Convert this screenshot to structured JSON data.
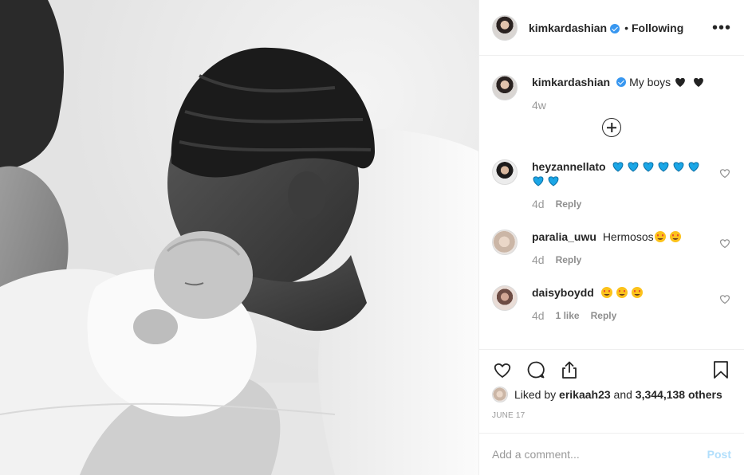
{
  "header": {
    "username": "kimkardashian",
    "separator": "•",
    "follow_status": "Following",
    "more_label": "•••"
  },
  "caption": {
    "username": "kimkardashian",
    "text": "My boys",
    "emoji": [
      "black-heart",
      "black-heart"
    ],
    "age": "4w"
  },
  "comments": [
    {
      "username": "heyzannellato",
      "text": "",
      "emoji": [
        "blue-heart",
        "blue-heart",
        "blue-heart",
        "blue-heart",
        "blue-heart",
        "blue-heart",
        "blue-heart",
        "blue-heart"
      ],
      "age": "4d",
      "likes": "",
      "reply_label": "Reply"
    },
    {
      "username": "paralia_uwu",
      "text": "Hermosos",
      "emoji": [
        "heart-eyes-face",
        "heart-eyes-face"
      ],
      "age": "4d",
      "likes": "",
      "reply_label": "Reply"
    },
    {
      "username": "daisyboydd",
      "text": "",
      "emoji": [
        "heart-eyes-face",
        "heart-eyes-face",
        "heart-eyes-face"
      ],
      "age": "4d",
      "likes": "1 like",
      "reply_label": "Reply"
    }
  ],
  "likes": {
    "prefix": "Liked by",
    "user": "erikaah23",
    "and": "and",
    "others": "3,344,138 others"
  },
  "date": "JUNE 17",
  "add_comment": {
    "placeholder": "Add a comment...",
    "post_label": "Post"
  },
  "colors": {
    "verified": "#3897f0",
    "post_disabled": "#b2dffc",
    "blue_heart": "#1ba6e6",
    "muted_text": "#8e8e8e"
  }
}
